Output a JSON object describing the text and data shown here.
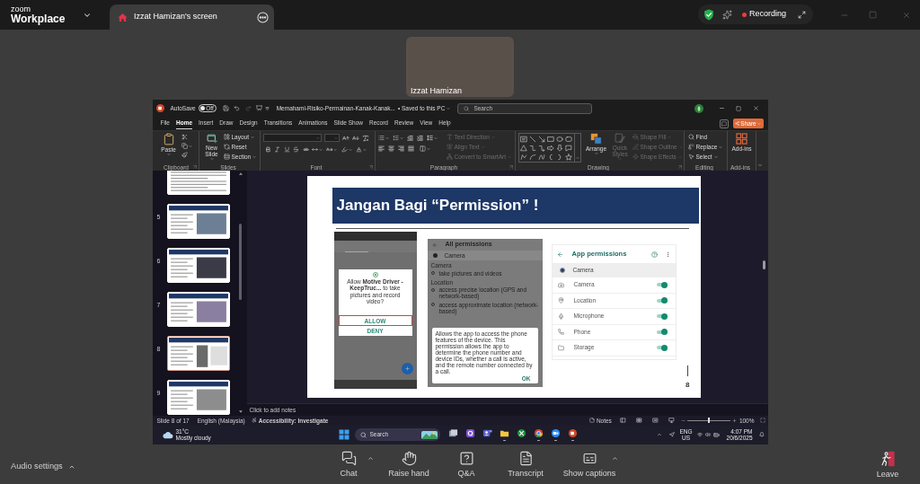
{
  "zoom_header": {
    "brand_small": "zoom",
    "brand_large": "Workplace",
    "share_tab": {
      "title": "Izzat Hamizan's screen"
    },
    "recording_label": "Recording"
  },
  "video_tile": {
    "name": "Izzat Hamizan"
  },
  "powerpoint": {
    "title_bar": {
      "autosave_label": "AutoSave",
      "autosave_toggle": {
        "label": "Off",
        "on": false
      },
      "file_name": "Memahami-Risiko-Permainan-Kanak-Kanak...",
      "save_status": "• Saved to this PC",
      "search_placeholder": "Search"
    },
    "menu_tabs": [
      {
        "label": "File",
        "selected": false
      },
      {
        "label": "Home",
        "selected": true
      },
      {
        "label": "Insert",
        "selected": false
      },
      {
        "label": "Draw",
        "selected": false
      },
      {
        "label": "Design",
        "selected": false
      },
      {
        "label": "Transitions",
        "selected": false
      },
      {
        "label": "Animations",
        "selected": false
      },
      {
        "label": "Slide Show",
        "selected": false
      },
      {
        "label": "Record",
        "selected": false
      },
      {
        "label": "Review",
        "selected": false
      },
      {
        "label": "View",
        "selected": false
      },
      {
        "label": "Help",
        "selected": false
      }
    ],
    "share_button": "Share",
    "ribbon": {
      "clipboard": {
        "label": "Clipboard",
        "paste": "Paste"
      },
      "slides": {
        "label": "Slides",
        "new_slide": "New Slide",
        "commands": [
          "Layout",
          "Reset",
          "Section"
        ]
      },
      "font": {
        "label": "Font"
      },
      "paragraph": {
        "label": "Paragraph",
        "text_commands": [
          {
            "label": "Text Direction",
            "disabled": true
          },
          {
            "label": "Align Text",
            "disabled": true
          },
          {
            "label": "Convert to SmartArt",
            "disabled": true
          }
        ]
      },
      "drawing": {
        "label": "Drawing",
        "arrange": "Arrange",
        "quick_styles": {
          "label": "Quick Styles",
          "disabled": true
        },
        "shape_commands": [
          {
            "label": "Shape Fill",
            "disabled": true
          },
          {
            "label": "Shape Outline",
            "disabled": true
          },
          {
            "label": "Shape Effects",
            "disabled": true
          }
        ]
      },
      "editing": {
        "label": "Editing",
        "commands": [
          "Find",
          "Replace",
          "Select"
        ]
      },
      "add_ins": {
        "label": "Add-ins",
        "button": "Add-ins"
      }
    },
    "slide_thumbnails": [
      {
        "selected": false
      },
      {
        "number": "5",
        "selected": false
      },
      {
        "number": "6",
        "selected": false
      },
      {
        "number": "7",
        "selected": false
      },
      {
        "number": "8",
        "selected": true
      },
      {
        "number": "9",
        "selected": false
      }
    ],
    "slide": {
      "title": "Jangan Bagi “Permission” !",
      "permission_prompt": {
        "message": "Allow **Motive Driver - KeepTruc...** to take pictures and record video?",
        "allow": "ALLOW",
        "deny": "DENY"
      },
      "all_permissions": {
        "title": "All permissions",
        "app": "Camera",
        "groups": [
          {
            "heading": "Camera",
            "items": [
              "take pictures and videos"
            ]
          },
          {
            "heading": "Location",
            "items": [
              "access precise location (GPS and network-based)",
              "access approximate location (network-based)"
            ]
          }
        ],
        "dialog": {
          "text": "Allows the app to access the phone features of the device. This permission allows the app to determine the phone number and device IDs, whether a call is active, and the remote number connected by a call.",
          "button": "OK"
        }
      },
      "app_permissions": {
        "title": "App permissions",
        "app": "Camera",
        "permissions": [
          {
            "label": "Camera",
            "on": true
          },
          {
            "label": "Location",
            "on": true
          },
          {
            "label": "Microphone",
            "on": true
          },
          {
            "label": "Phone",
            "on": true
          },
          {
            "label": "Storage",
            "on": true
          }
        ]
      },
      "page_number": "8"
    },
    "notes_placeholder": "Click to add notes",
    "status_bar": {
      "slide_position": "Slide 8 of 17",
      "language": "English (Malaysia)",
      "accessibility": "Accessibility: Investigate",
      "notes_label": "Notes",
      "zoom": {
        "level": 0.5,
        "reading": "100%"
      }
    },
    "taskbar": {
      "weather": {
        "temperature": "31°C",
        "condition": "Mostly cloudy"
      },
      "search_placeholder": "Search",
      "apps": [
        {
          "running": false
        },
        {
          "running": false
        },
        {
          "running": false
        },
        {
          "running": true
        },
        {
          "running": false
        },
        {
          "running": true
        },
        {
          "running": true
        },
        {
          "running": true
        }
      ],
      "input_language": "ENG",
      "input_region": "US",
      "time": "4:07 PM",
      "date": "20/6/2025"
    }
  },
  "meeting_controls": {
    "audio_settings": "Audio settings",
    "buttons": [
      {
        "label": "Chat"
      },
      {
        "label": "Raise hand"
      },
      {
        "label": "Q&A"
      },
      {
        "label": "Transcript"
      },
      {
        "label": "Show captions"
      }
    ],
    "leave": "Leave"
  }
}
